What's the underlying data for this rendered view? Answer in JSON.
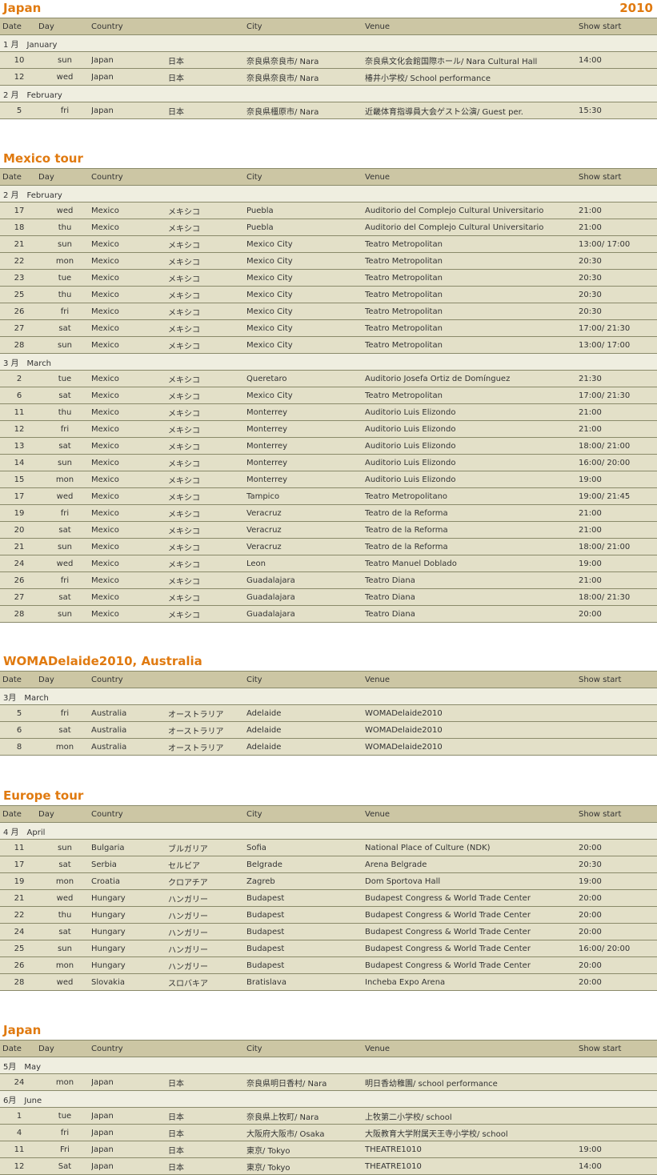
{
  "year": "2010",
  "headers": {
    "date": "Date",
    "day": "Day",
    "country": "Country",
    "city": "City",
    "venue": "Venue",
    "show": "Show start"
  },
  "sections": [
    {
      "title": "Japan",
      "groups": [
        {
          "month": "1 月　January",
          "rows": [
            {
              "date": "10",
              "day": "sun",
              "country": "Japan",
              "country_jp": "日本",
              "city": "奈良県奈良市/ Nara",
              "venue": "奈良県文化会館国際ホール/ Nara Cultural Hall",
              "show": "14:00"
            },
            {
              "date": "12",
              "day": "wed",
              "country": "Japan",
              "country_jp": "日本",
              "city": "奈良県奈良市/ Nara",
              "venue": "椿井小学校/ School performance",
              "show": ""
            }
          ]
        },
        {
          "month": "2 月　February",
          "rows": [
            {
              "date": "5",
              "day": "fri",
              "country": "Japan",
              "country_jp": "日本",
              "city": "奈良県橿原市/ Nara",
              "venue": "近畿体育指導員大会ゲスト公演/ Guest per.",
              "show": "15:30"
            }
          ]
        }
      ]
    },
    {
      "title": "Mexico tour",
      "groups": [
        {
          "month": "2 月　February",
          "rows": [
            {
              "date": "17",
              "day": "wed",
              "country": "Mexico",
              "country_jp": "メキシコ",
              "city": "Puebla",
              "venue": "Auditorio del Complejo Cultural Universitario",
              "show": "21:00"
            },
            {
              "date": "18",
              "day": "thu",
              "country": "Mexico",
              "country_jp": "メキシコ",
              "city": "Puebla",
              "venue": "Auditorio del Complejo Cultural Universitario",
              "show": "21:00"
            },
            {
              "date": "21",
              "day": "sun",
              "country": "Mexico",
              "country_jp": "メキシコ",
              "city": "Mexico City",
              "venue": "Teatro Metropolitan",
              "show": "13:00/ 17:00"
            },
            {
              "date": "22",
              "day": "mon",
              "country": "Mexico",
              "country_jp": "メキシコ",
              "city": "Mexico City",
              "venue": "Teatro Metropolitan",
              "show": "20:30"
            },
            {
              "date": "23",
              "day": "tue",
              "country": "Mexico",
              "country_jp": "メキシコ",
              "city": "Mexico City",
              "venue": "Teatro Metropolitan",
              "show": "20:30"
            },
            {
              "date": "25",
              "day": "thu",
              "country": "Mexico",
              "country_jp": "メキシコ",
              "city": "Mexico City",
              "venue": "Teatro Metropolitan",
              "show": "20:30"
            },
            {
              "date": "26",
              "day": "fri",
              "country": "Mexico",
              "country_jp": "メキシコ",
              "city": "Mexico City",
              "venue": "Teatro Metropolitan",
              "show": "20:30"
            },
            {
              "date": "27",
              "day": "sat",
              "country": "Mexico",
              "country_jp": "メキシコ",
              "city": "Mexico City",
              "venue": "Teatro Metropolitan",
              "show": "17:00/ 21:30"
            },
            {
              "date": "28",
              "day": "sun",
              "country": "Mexico",
              "country_jp": "メキシコ",
              "city": "Mexico City",
              "venue": "Teatro Metropolitan",
              "show": "13:00/ 17:00"
            }
          ]
        },
        {
          "month": "3 月　March",
          "rows": [
            {
              "date": "2",
              "day": "tue",
              "country": "Mexico",
              "country_jp": "メキシコ",
              "city": "Queretaro",
              "venue": "Auditorio Josefa Ortiz de Domínguez",
              "show": "21:30"
            },
            {
              "date": "6",
              "day": "sat",
              "country": "Mexico",
              "country_jp": "メキシコ",
              "city": "Mexico City",
              "venue": "Teatro Metropolitan",
              "show": "17:00/ 21:30"
            },
            {
              "date": "11",
              "day": "thu",
              "country": "Mexico",
              "country_jp": "メキシコ",
              "city": "Monterrey",
              "venue": "Auditorio Luis Elizondo",
              "show": "21:00"
            },
            {
              "date": "12",
              "day": "fri",
              "country": "Mexico",
              "country_jp": "メキシコ",
              "city": "Monterrey",
              "venue": "Auditorio Luis Elizondo",
              "show": "21:00"
            },
            {
              "date": "13",
              "day": "sat",
              "country": "Mexico",
              "country_jp": "メキシコ",
              "city": "Monterrey",
              "venue": "Auditorio Luis Elizondo",
              "show": "18:00/ 21:00"
            },
            {
              "date": "14",
              "day": "sun",
              "country": "Mexico",
              "country_jp": "メキシコ",
              "city": "Monterrey",
              "venue": "Auditorio Luis Elizondo",
              "show": "16:00/ 20:00"
            },
            {
              "date": "15",
              "day": "mon",
              "country": "Mexico",
              "country_jp": "メキシコ",
              "city": "Monterrey",
              "venue": "Auditorio Luis Elizondo",
              "show": "19:00"
            },
            {
              "date": "17",
              "day": "wed",
              "country": "Mexico",
              "country_jp": "メキシコ",
              "city": "Tampico",
              "venue": "Teatro Metropolitano",
              "show": "19:00/ 21:45"
            },
            {
              "date": "19",
              "day": "fri",
              "country": "Mexico",
              "country_jp": "メキシコ",
              "city": "Veracruz",
              "venue": "Teatro de la Reforma",
              "show": "21:00"
            },
            {
              "date": "20",
              "day": "sat",
              "country": "Mexico",
              "country_jp": "メキシコ",
              "city": "Veracruz",
              "venue": "Teatro de la Reforma",
              "show": "21:00"
            },
            {
              "date": "21",
              "day": "sun",
              "country": "Mexico",
              "country_jp": "メキシコ",
              "city": "Veracruz",
              "venue": "Teatro de la Reforma",
              "show": "18:00/ 21:00"
            },
            {
              "date": "24",
              "day": "wed",
              "country": "Mexico",
              "country_jp": "メキシコ",
              "city": "Leon",
              "venue": "Teatro Manuel Doblado",
              "show": "19:00"
            },
            {
              "date": "26",
              "day": "fri",
              "country": "Mexico",
              "country_jp": "メキシコ",
              "city": "Guadalajara",
              "venue": "Teatro Diana",
              "show": "21:00"
            },
            {
              "date": "27",
              "day": "sat",
              "country": "Mexico",
              "country_jp": "メキシコ",
              "city": "Guadalajara",
              "venue": "Teatro Diana",
              "show": "18:00/ 21:30"
            },
            {
              "date": "28",
              "day": "sun",
              "country": "Mexico",
              "country_jp": "メキシコ",
              "city": "Guadalajara",
              "venue": "Teatro Diana",
              "show": "20:00"
            }
          ]
        }
      ]
    },
    {
      "title": "WOMADelaide2010, Australia",
      "groups": [
        {
          "month": "3月　March",
          "rows": [
            {
              "date": "5",
              "day": "fri",
              "country": "Australia",
              "country_jp": "オーストラリア",
              "city": "Adelaide",
              "venue": "WOMADelaide2010",
              "show": ""
            },
            {
              "date": "6",
              "day": "sat",
              "country": "Australia",
              "country_jp": "オーストラリア",
              "city": "Adelaide",
              "venue": "WOMADelaide2010",
              "show": ""
            },
            {
              "date": "8",
              "day": "mon",
              "country": "Australia",
              "country_jp": "オーストラリア",
              "city": "Adelaide",
              "venue": "WOMADelaide2010",
              "show": ""
            }
          ]
        }
      ]
    },
    {
      "title": "Europe tour",
      "groups": [
        {
          "month": "4 月　April",
          "rows": [
            {
              "date": "11",
              "day": "sun",
              "country": "Bulgaria",
              "country_jp": "ブルガリア",
              "city": "Sofia",
              "venue": "National Place of Culture (NDK)",
              "show": "20:00"
            },
            {
              "date": "17",
              "day": "sat",
              "country": "Serbia",
              "country_jp": "セルビア",
              "city": "Belgrade",
              "venue": "Arena Belgrade",
              "show": "20:30"
            },
            {
              "date": "19",
              "day": "mon",
              "country": "Croatia",
              "country_jp": "クロアチア",
              "city": "Zagreb",
              "venue": "Dom Sportova Hall",
              "show": "19:00"
            },
            {
              "date": "21",
              "day": "wed",
              "country": "Hungary",
              "country_jp": "ハンガリー",
              "city": "Budapest",
              "venue": "Budapest Congress & World Trade Center",
              "show": "20:00"
            },
            {
              "date": "22",
              "day": "thu",
              "country": "Hungary",
              "country_jp": "ハンガリー",
              "city": "Budapest",
              "venue": "Budapest Congress & World Trade Center",
              "show": "20:00"
            },
            {
              "date": "24",
              "day": "sat",
              "country": "Hungary",
              "country_jp": "ハンガリー",
              "city": "Budapest",
              "venue": "Budapest Congress & World Trade Center",
              "show": "20:00"
            },
            {
              "date": "25",
              "day": "sun",
              "country": "Hungary",
              "country_jp": "ハンガリー",
              "city": "Budapest",
              "venue": "Budapest Congress & World Trade Center",
              "show": "16:00/ 20:00"
            },
            {
              "date": "26",
              "day": "mon",
              "country": "Hungary",
              "country_jp": "ハンガリー",
              "city": "Budapest",
              "venue": "Budapest Congress & World Trade Center",
              "show": "20:00"
            },
            {
              "date": "28",
              "day": "wed",
              "country": "Slovakia",
              "country_jp": "スロバキア",
              "city": "Bratislava",
              "venue": "Incheba Expo Arena",
              "show": "20:00"
            }
          ]
        }
      ]
    },
    {
      "title": "Japan",
      "groups": [
        {
          "month": "5月　May",
          "rows": [
            {
              "date": "24",
              "day": "mon",
              "country": "Japan",
              "country_jp": "日本",
              "city": "奈良県明日香村/ Nara",
              "venue": "明日香幼稚園/ school performance",
              "show": ""
            }
          ]
        },
        {
          "month": "6月　June",
          "rows": [
            {
              "date": "1",
              "day": "tue",
              "country": "Japan",
              "country_jp": "日本",
              "city": "奈良県上牧町/ Nara",
              "venue": "上牧第二小学校/ school",
              "show": ""
            },
            {
              "date": "4",
              "day": "fri",
              "country": "Japan",
              "country_jp": "日本",
              "city": "大阪府大阪市/ Osaka",
              "venue": "大阪教育大学附属天王寺小学校/ school",
              "show": ""
            },
            {
              "date": "11",
              "day": "Fri",
              "country": "Japan",
              "country_jp": "日本",
              "city": "東京/ Tokyo",
              "venue": "THEATRE1010",
              "show": "19:00"
            },
            {
              "date": "12",
              "day": "Sat",
              "country": "Japan",
              "country_jp": "日本",
              "city": "東京/ Tokyo",
              "venue": "THEATRE1010",
              "show": "14:00"
            }
          ]
        }
      ]
    }
  ]
}
